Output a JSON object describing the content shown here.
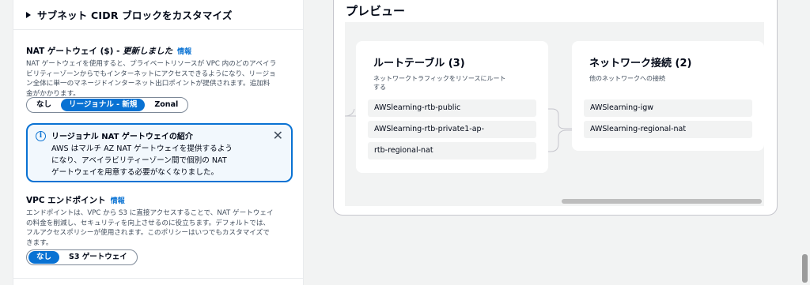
{
  "subnet_cidr": {
    "label": "サブネット CIDR ブロックをカスタマイズ"
  },
  "nat_gateway": {
    "title": "NAT ゲートウェイ ($) - ",
    "title_italic": "更新しました",
    "info": "情報",
    "description_lines": [
      "NAT ゲートウェイを使用すると、プライベートリソースが VPC 内のどのアベイラ",
      "ビリティーゾーンからでもインターネットにアクセスできるようになり、リージョ",
      "ン全体に単一のマネージドインターネット出口ポイントが提供されます。追加料",
      "金がかかります。"
    ],
    "options": [
      "なし",
      "リージョナル - 新規",
      "Zonal"
    ],
    "selected": "リージョナル - 新規"
  },
  "alert": {
    "title": "リージョナル NAT ゲートウェイの紹介",
    "body_lines": [
      "AWS はマルチ AZ NAT ゲートウェイを提供するよう",
      "になり、アベイラビリティーゾーン間で個別の NAT",
      "ゲートウェイを用意する必要がなくなりました。"
    ]
  },
  "vpc_endpoint": {
    "title": "VPC エンドポイント",
    "info": "情報",
    "description_lines": [
      "エンドポイントは、VPC から S3 に直接アクセスすることで、NAT ゲートウェイ",
      "の料金を削減し、セキュリティを向上させるのに役立ちます。デフォルトでは、",
      "フルアクセスポリシーが使用されます。このポリシーはいつでもカスタマイズで",
      "きます。"
    ],
    "options": [
      "なし",
      "S3 ゲートウェイ"
    ],
    "selected": "なし"
  },
  "preview": {
    "title": "プレビュー",
    "route_tables": {
      "title": "ルートテーブル (3)",
      "description_lines": [
        "ネットワークトラフィックをリソースにルート",
        "する"
      ],
      "items": [
        "AWSlearning-rtb-public",
        "AWSlearning-rtb-private1-ap-",
        "rtb-regional-nat"
      ]
    },
    "network_connections": {
      "title": "ネットワーク接続 (2)",
      "description": "他のネットワークへの接続",
      "items": [
        "AWSlearning-igw",
        "AWSlearning-regional-nat"
      ]
    }
  },
  "colors": {
    "accent": "#0972d3",
    "alert_background": "#f2f8fd",
    "page_background": "#f2f3f3"
  }
}
